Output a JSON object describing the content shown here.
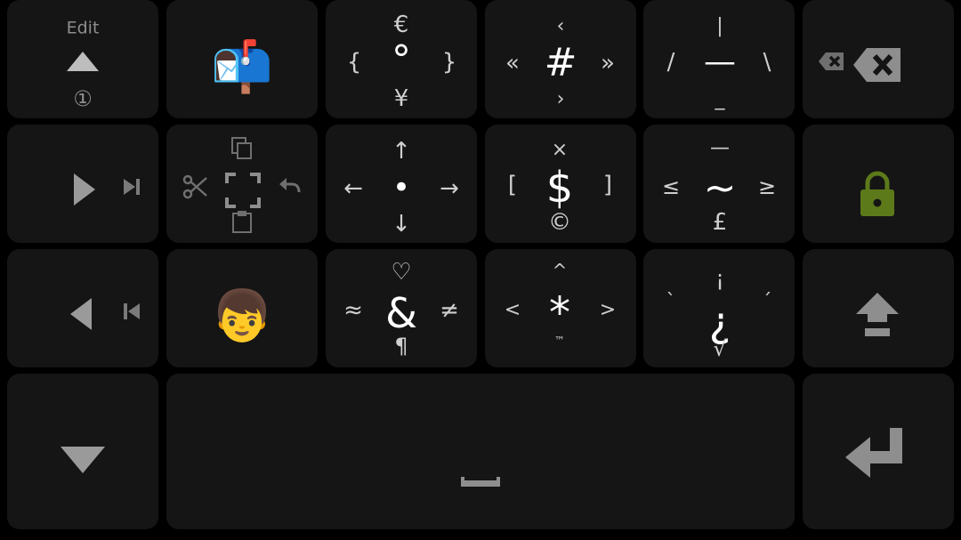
{
  "colors": {
    "background": "#000000",
    "key": "#151515",
    "symbol": "#d2d2d2",
    "symbol_main": "#ffffff",
    "icon_gray": "#8e8e8e",
    "lock_green": "#5d7a1a"
  },
  "keys": {
    "edit": {
      "label": "Edit",
      "bottom": "①",
      "icon": "triangle-up-icon"
    },
    "mailbox": {
      "emoji": "📬"
    },
    "euro_deg": {
      "top": "€",
      "left": "{",
      "center": "°",
      "right": "}",
      "bottom": "¥"
    },
    "hash": {
      "top": "‹",
      "left": "«",
      "center": "#",
      "right": "»",
      "bottom": "›"
    },
    "bar": {
      "top": "|",
      "left": "/",
      "center": "—",
      "right": "\\",
      "bottom": "_"
    },
    "backspace": {
      "icons": [
        "delete-word-icon",
        "backspace-icon"
      ]
    },
    "right_arrow": {
      "icons": [
        "play-right-icon",
        "skip-end-icon"
      ]
    },
    "clipboard": {
      "icons": [
        "copy-icon",
        "cut-icon",
        "select-all-icon",
        "undo-icon",
        "paste-icon"
      ]
    },
    "arrows": {
      "top": "↑",
      "left": "←",
      "center": "•",
      "right": "→",
      "bottom": "↓"
    },
    "dollar": {
      "top": "×",
      "left": "[",
      "center": "$",
      "right": "]",
      "bottom": "©"
    },
    "tilde": {
      "top": "—",
      "left": "≤",
      "center": "~",
      "right": "≥",
      "bottom": "£"
    },
    "lock": {
      "icon": "lock-icon"
    },
    "left_arrow": {
      "icons": [
        "play-left-icon",
        "skip-start-icon"
      ]
    },
    "boy": {
      "emoji": "👦"
    },
    "amp": {
      "top": "♡",
      "left": "≈",
      "center": "&",
      "right": "≠",
      "bottom": "¶"
    },
    "star": {
      "top": "^",
      "left": "<",
      "center": "*",
      "right": ">",
      "bottom": "™"
    },
    "inv_q": {
      "top": "¡",
      "left": "`",
      "center": "¿",
      "right": "´",
      "bottom": "√"
    },
    "shift": {
      "icon": "shift-icon"
    },
    "down": {
      "icon": "triangle-down-icon"
    },
    "space": {
      "icon": "space-bar-icon"
    },
    "enter": {
      "icon": "enter-icon"
    }
  }
}
